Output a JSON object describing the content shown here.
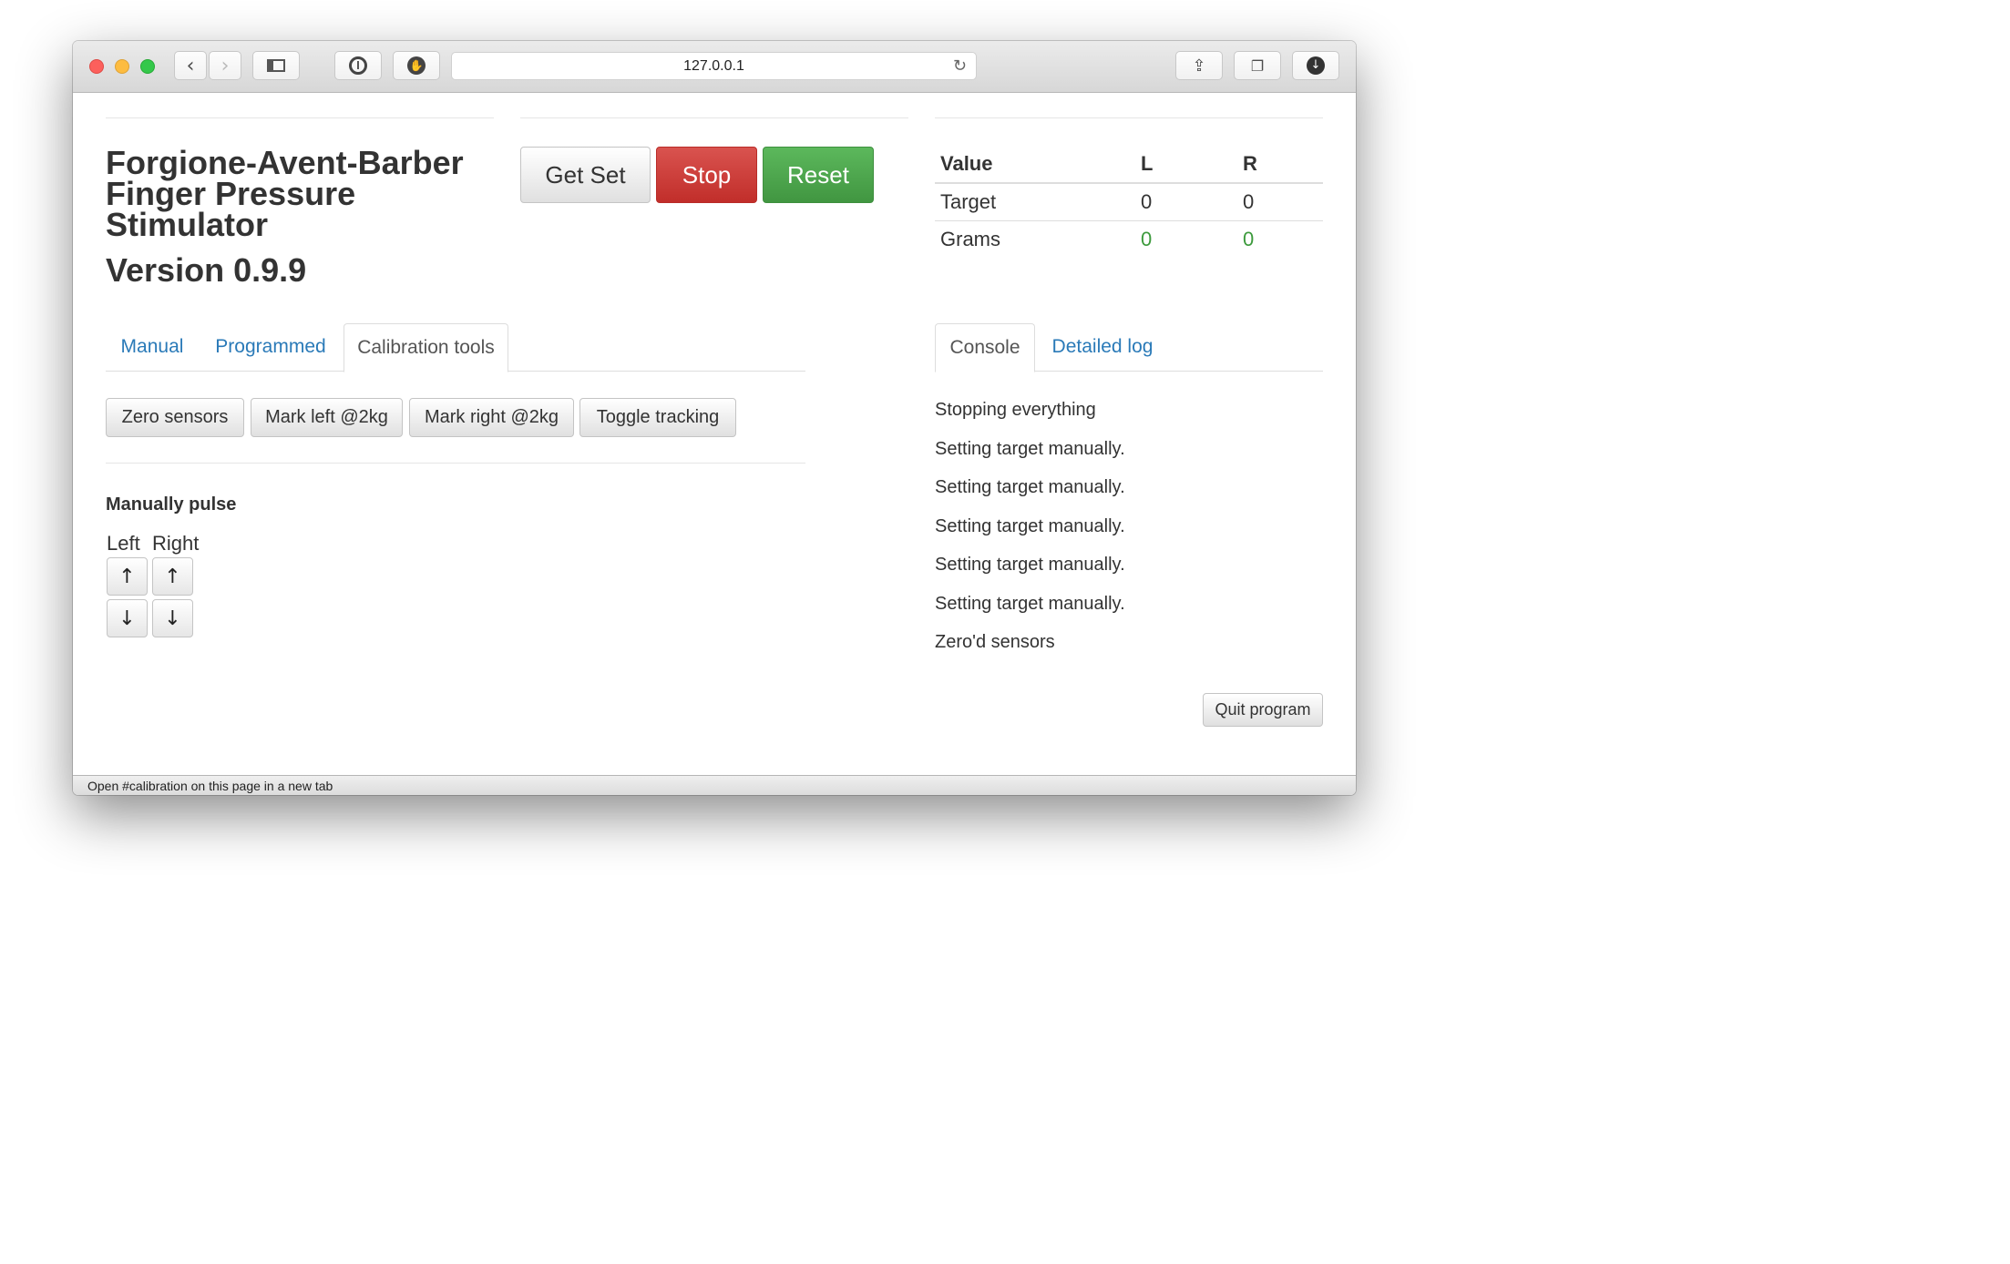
{
  "browser": {
    "url": "127.0.0.1",
    "status_text": "Open #calibration on this page in a new tab"
  },
  "header": {
    "title": "Forgione-Avent-Barber Finger Pressure Stimulator",
    "version": "Version 0.9.9"
  },
  "controls": {
    "get_set": "Get Set",
    "stop": "Stop",
    "reset": "Reset"
  },
  "values_table": {
    "headers": [
      "Value",
      "L",
      "R"
    ],
    "rows": [
      {
        "label": "Target",
        "l": "0",
        "r": "0"
      },
      {
        "label": "Grams",
        "l": "0",
        "r": "0"
      }
    ]
  },
  "left_tabs": [
    "Manual",
    "Programmed",
    "Calibration tools"
  ],
  "calibration": {
    "buttons": [
      "Zero sensors",
      "Mark left @2kg",
      "Mark right @2kg",
      "Toggle tracking"
    ],
    "pulse_label": "Manually pulse",
    "left": "Left",
    "right": "Right",
    "up": "↑",
    "down": "↓"
  },
  "right_tabs": [
    "Console",
    "Detailed log"
  ],
  "console": [
    "Stopping everything",
    "Setting target manually.",
    "Setting target manually.",
    "Setting target manually.",
    "Setting target manually.",
    "Setting target manually.",
    "Zero'd sensors"
  ],
  "quit_label": "Quit program",
  "colors": {
    "danger": "#d9534f",
    "success": "#5cb85c",
    "link": "#2a7ab8",
    "grams_value": "#3c9a3c"
  }
}
